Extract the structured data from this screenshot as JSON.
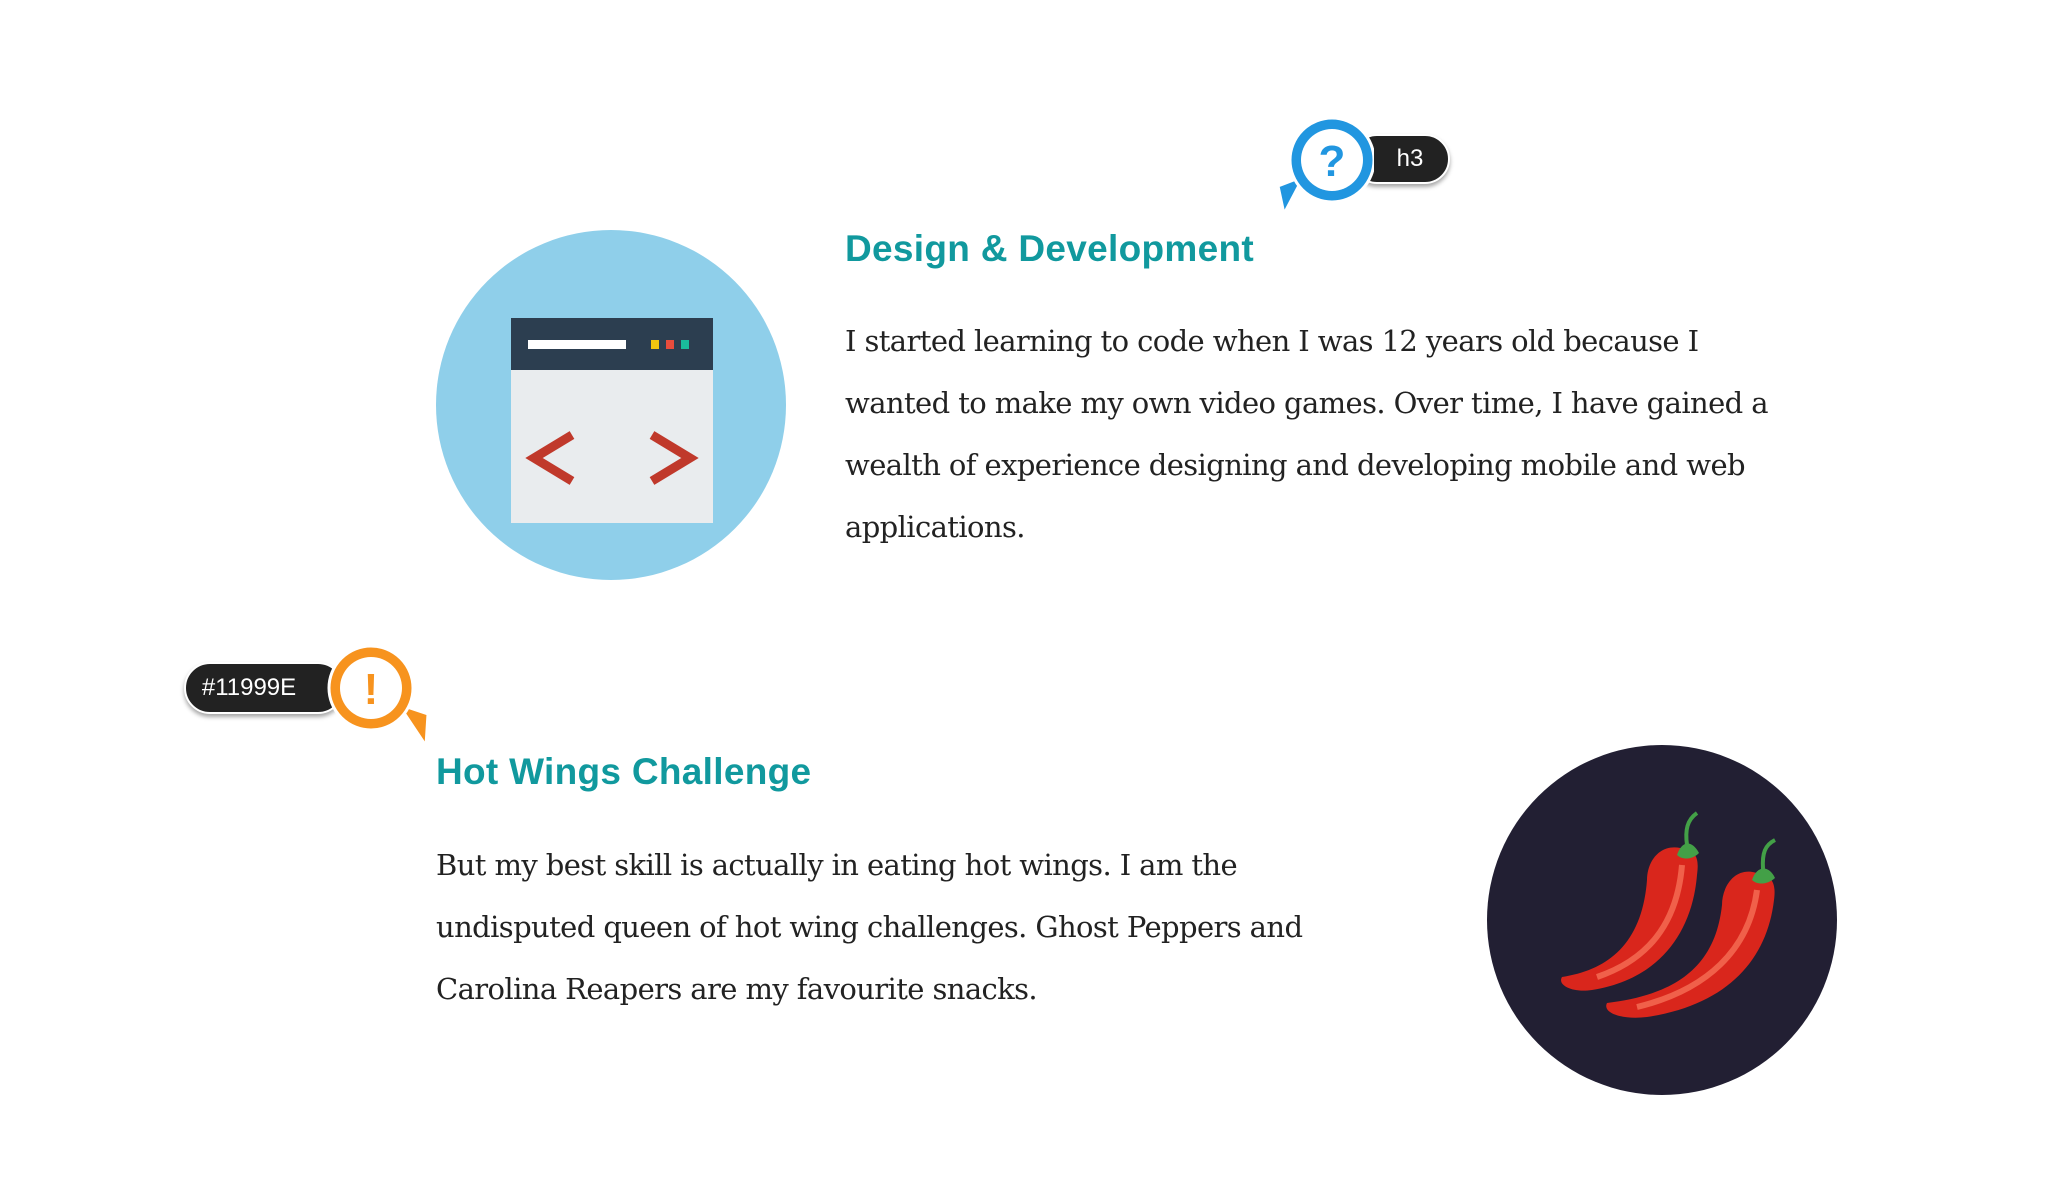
{
  "sections": [
    {
      "heading": "Design & Development",
      "paragraph_lines": [
        "I started learning to code when I was 12 years old because I",
        "wanted to make my own video games. Over time, I have gained a",
        "wealth of experience designing and developing mobile and web",
        "applications."
      ],
      "image_icon": "code-window-icon"
    },
    {
      "heading": "Hot Wings Challenge",
      "paragraph_lines": [
        "But my best skill is actually in eating hot wings. I am the",
        "undisputed queen of hot wing challenges. Ghost Peppers and",
        "Carolina Reapers are my favourite snacks."
      ],
      "image_icon": "chili-peppers-icon"
    }
  ],
  "annotations": {
    "h3_badge": {
      "label": "h3",
      "icon": "question-icon",
      "color": "#2196E0"
    },
    "color_badge": {
      "label": "#11999E",
      "icon": "exclamation-icon",
      "color": "#F7931E"
    }
  },
  "colors": {
    "heading": "#11999E",
    "text": "#222222",
    "circle1": "#8FCFEA",
    "circle2": "#221F33"
  }
}
